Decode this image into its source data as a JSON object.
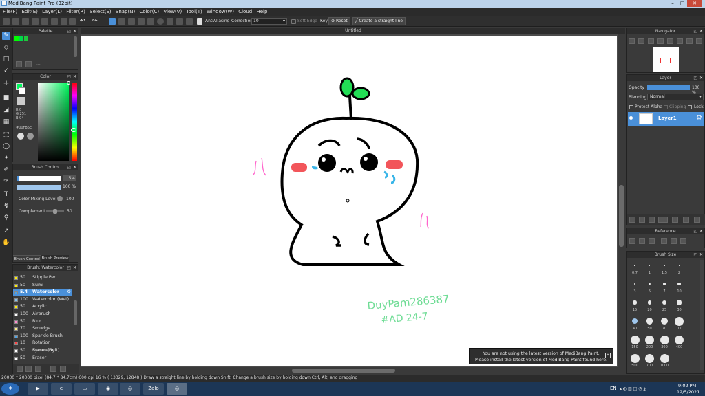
{
  "window": {
    "title": "MediBang Paint Pro (32bit)"
  },
  "menu": [
    "File(F)",
    "Edit(E)",
    "Layer(L)",
    "Filter(R)",
    "Select(S)",
    "Snap(N)",
    "Color(C)",
    "View(V)",
    "Tool(T)",
    "Window(W)",
    "Cloud",
    "Help"
  ],
  "toolbar": {
    "antialias_label": "AntiAliasing",
    "correction_label": "Correction",
    "correction_value": "10",
    "soft_edge_label": "Soft Edge",
    "key_label": "Key",
    "reset_label": "Reset",
    "straight_line_label": "Create a straight line"
  },
  "document": {
    "tab_title": "Untitled"
  },
  "palette": {
    "title": "Palette",
    "swatches": [
      "#00ff00",
      "#00d84a",
      "#1ec83c"
    ]
  },
  "color": {
    "title": "Color",
    "rgb_r": "R:0",
    "rgb_g": "G:251",
    "rgb_b": "B:94",
    "hex": "#00FB5E",
    "accent": "#00fb5e"
  },
  "brush_control": {
    "title": "Brush Control",
    "size_value": "5.4",
    "opacity_value": "100 %",
    "mixing_label": "Color Mixing Level",
    "mixing_value": "100",
    "complement_label": "Complement",
    "complement_value": "50",
    "tab_control": "Brush Control",
    "tab_preview": "Brush Preview"
  },
  "brush_list": {
    "title": "Brush: Watercolor",
    "items": [
      {
        "size": "50",
        "name": "Stipple Pen",
        "color": "#ffee00",
        "selected": false
      },
      {
        "size": "50",
        "name": "Sumi",
        "color": "#ffee00",
        "selected": false
      },
      {
        "size": "5.4",
        "name": "Watercolor",
        "color": "#4aa3e8",
        "selected": true
      },
      {
        "size": "100",
        "name": "Watercolor (Wet)",
        "color": "#7fc0f0",
        "selected": false
      },
      {
        "size": "50",
        "name": "Acrylic",
        "color": "#ffee00",
        "selected": false
      },
      {
        "size": "100",
        "name": "Airbrush",
        "color": "#ffffff",
        "selected": false
      },
      {
        "size": "50",
        "name": "Blur",
        "color": "#ff88cc",
        "selected": false
      },
      {
        "size": "70",
        "name": "Smudge",
        "color": "#ffee88",
        "selected": false
      },
      {
        "size": "100",
        "name": "Sparkle Brush",
        "color": "#4aa3e8",
        "selected": false
      },
      {
        "size": "10",
        "name": "Rotation Symmetry",
        "color": "#ff4444",
        "selected": false
      },
      {
        "size": "50",
        "name": "Eraser (Soft)",
        "color": "#ffffff",
        "selected": false
      },
      {
        "size": "50",
        "name": "Eraser",
        "color": "#ffffff",
        "selected": false
      }
    ]
  },
  "navigator": {
    "title": "Navigator"
  },
  "layer": {
    "title": "Layer",
    "opacity_label": "Opacity",
    "opacity_value": "100 %",
    "blending_label": "Blending",
    "blending_value": "Normal",
    "protect_alpha": "Protect Alpha",
    "clipping": "Clipping",
    "lock": "Lock",
    "layers": [
      {
        "name": "Layer1"
      }
    ]
  },
  "reference": {
    "title": "Reference"
  },
  "brush_size": {
    "title": "Brush Size",
    "sizes": [
      "0.7",
      "1",
      "1.5",
      "2",
      "3",
      "5",
      "7",
      "10",
      "15",
      "20",
      "25",
      "30",
      "40",
      "50",
      "70",
      "100",
      "150",
      "200",
      "300",
      "400",
      "500",
      "700",
      "1000"
    ],
    "selected": "40"
  },
  "notice": {
    "line1": "You are not using the latest version of MediBang Paint.",
    "line2": "Please install the latest version of MediBang Paint found here."
  },
  "canvas_handwriting": {
    "line1": "DuyPam286387",
    "line2": "#AD 24-7"
  },
  "status": {
    "text": "20000 * 20000 pixel  (84.7 * 84.7cm)  600 dpi  16 %  ( 13329, 12848 )  Draw a straight line by holding down Shift, Change a brush size by holding down Ctrl, Alt, and dragging"
  },
  "taskbar": {
    "apps": [
      "start",
      "media-player",
      "ie",
      "explorer",
      "green-app",
      "chrome",
      "Zalo",
      "chrome-2"
    ],
    "zalo_label": "Zalo",
    "lang": "EN",
    "time": "9:02 PM",
    "date": "12/5/2021"
  }
}
